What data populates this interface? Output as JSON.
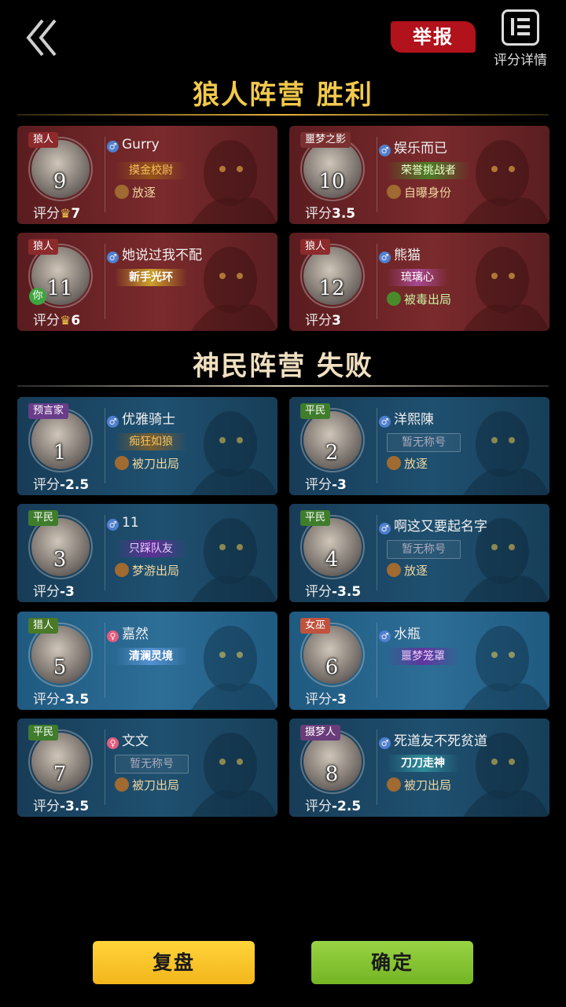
{
  "header": {
    "report_label": "举报",
    "detail_label": "评分详情"
  },
  "sections": [
    {
      "title": "狼人阵营  胜利",
      "color": "#f2c94c",
      "players": [
        {
          "role": "狼人",
          "seat": "9",
          "name": "Gurry",
          "gender": "m",
          "tag1": "摸金校尉",
          "tag1_style": "gold",
          "tag2": "放逐",
          "tag2_style": "",
          "score_label": "评分",
          "score": "7",
          "crown": true
        },
        {
          "role": "噩梦之影",
          "seat": "10",
          "name": "娱乐而已",
          "gender": "m",
          "tag1": "荣誉挑战者",
          "tag1_style": "green",
          "tag2": "自曝身份",
          "tag2_style": "",
          "score_label": "评分",
          "score": "3.5",
          "crown": false
        },
        {
          "role": "狼人",
          "seat": "11",
          "name": "她说过我不配",
          "gender": "m",
          "tag1": "新手光环",
          "tag1_style": "yellow",
          "tag2": "",
          "tag2_style": "",
          "score_label": "评分",
          "score": "6",
          "crown": true,
          "you": "你"
        },
        {
          "role": "狼人",
          "seat": "12",
          "name": "熊猫",
          "gender": "m",
          "tag1": "琉璃心",
          "tag1_style": "pink",
          "tag2": "被毒出局",
          "tag2_style": "green",
          "score_label": "评分",
          "score": "3",
          "crown": false
        }
      ]
    },
    {
      "title": "神民阵营  失败",
      "color": "#f0e0c0",
      "players": [
        {
          "role": "预言家",
          "seat": "1",
          "name": "优雅骑士",
          "gender": "m",
          "tag1": "痴狂如狼",
          "tag1_style": "gold",
          "tag2": "被刀出局",
          "tag2_style": "",
          "score_label": "评分",
          "score": "-2.5",
          "crown": false
        },
        {
          "role": "平民",
          "seat": "2",
          "name": "洋熙陳",
          "gender": "m",
          "tag1": "暂无称号",
          "tag1_style": "none",
          "tag2": "放逐",
          "tag2_style": "",
          "score_label": "评分",
          "score": "-3",
          "crown": false
        },
        {
          "role": "平民",
          "seat": "3",
          "name": "11",
          "gender": "m",
          "tag1": "只踩队友",
          "tag1_style": "purple",
          "tag2": "梦游出局",
          "tag2_style": "",
          "score_label": "评分",
          "score": "-3",
          "crown": false
        },
        {
          "role": "平民",
          "seat": "4",
          "name": "啊这又要起名字",
          "gender": "m",
          "tag1": "暂无称号",
          "tag1_style": "none",
          "tag2": "放逐",
          "tag2_style": "",
          "score_label": "评分",
          "score": "-3.5",
          "crown": false
        },
        {
          "role": "猎人",
          "seat": "5",
          "name": "嘉然",
          "gender": "f",
          "tag1": "清澜灵境",
          "tag1_style": "blue",
          "tag2": "",
          "tag2_style": "",
          "score_label": "评分",
          "score": "-3.5",
          "crown": false
        },
        {
          "role": "女巫",
          "seat": "6",
          "name": "水瓶",
          "gender": "m",
          "tag1": "噩梦笼罩",
          "tag1_style": "purple",
          "tag2": "",
          "tag2_style": "",
          "score_label": "评分",
          "score": "-3",
          "crown": false
        },
        {
          "role": "平民",
          "seat": "7",
          "name": "文文",
          "gender": "f",
          "tag1": "暂无称号",
          "tag1_style": "none",
          "tag2": "被刀出局",
          "tag2_style": "",
          "score_label": "评分",
          "score": "-3.5",
          "crown": false
        },
        {
          "role": "摄梦人",
          "seat": "8",
          "name": "死道友不死贫道",
          "gender": "m",
          "tag1": "刀刀走神",
          "tag1_style": "teal",
          "tag2": "被刀出局",
          "tag2_style": "",
          "score_label": "评分",
          "score": "-2.5",
          "crown": false
        }
      ]
    }
  ],
  "footer": {
    "replay_label": "复盘",
    "confirm_label": "确定"
  }
}
